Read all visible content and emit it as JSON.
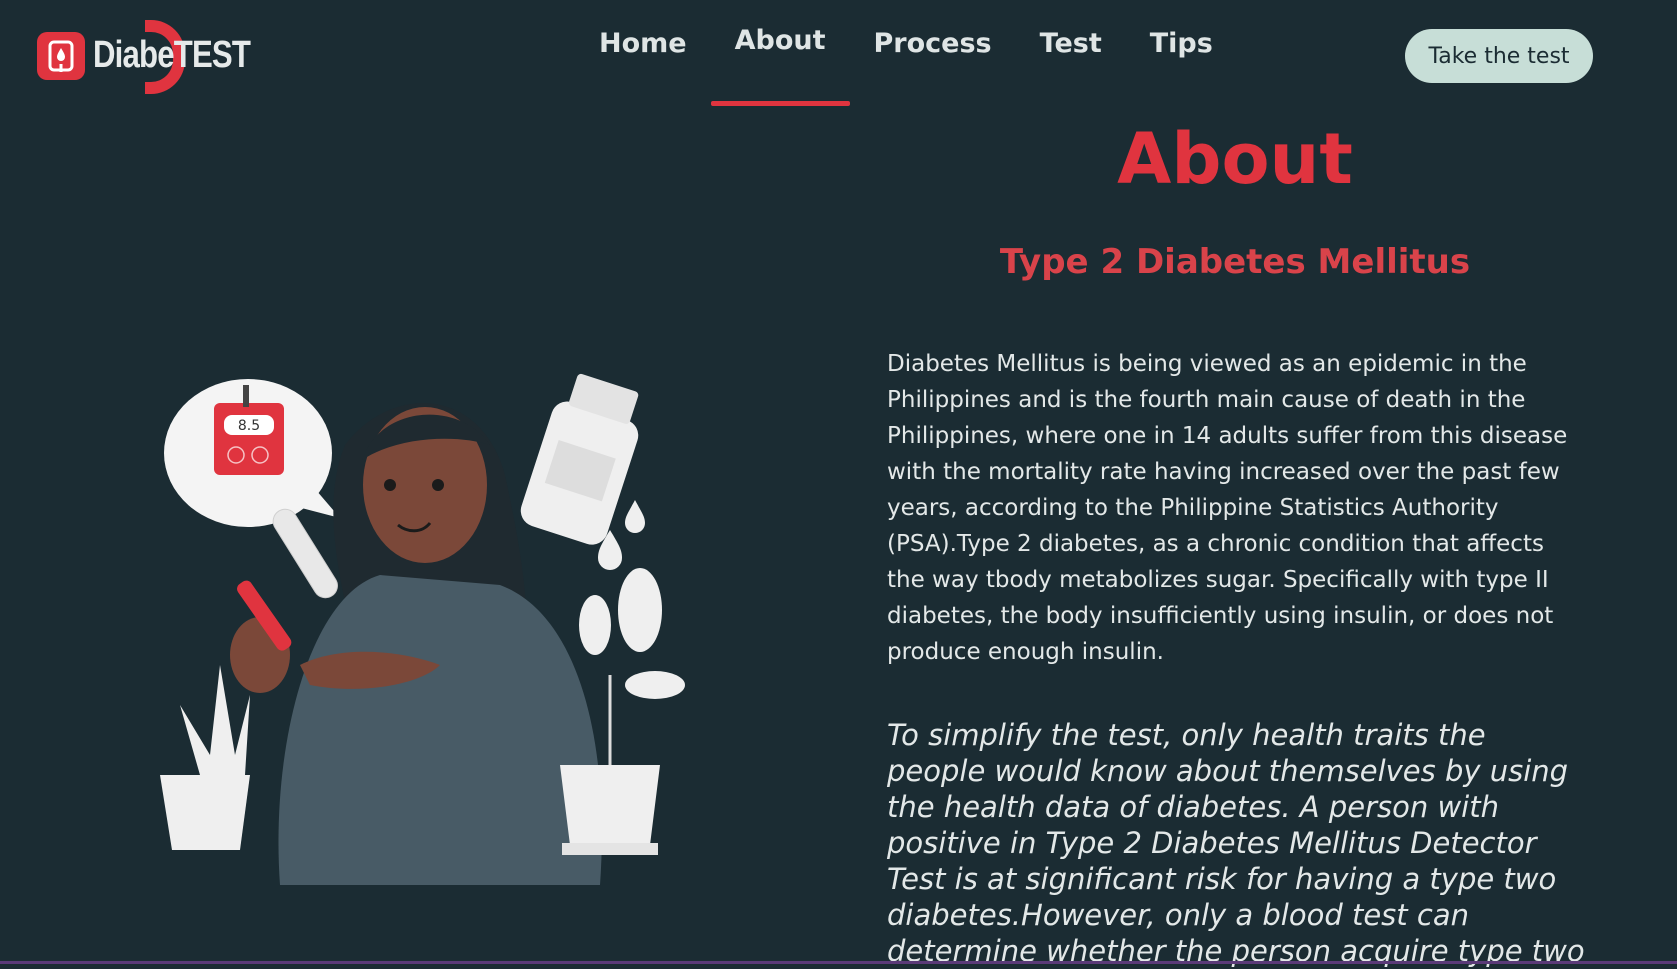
{
  "brand": {
    "logo_text": "DiabeTEST"
  },
  "nav": {
    "items": [
      {
        "label": "Home"
      },
      {
        "label": "About"
      },
      {
        "label": "Process"
      },
      {
        "label": "Test"
      },
      {
        "label": "Tips"
      }
    ],
    "active": "About",
    "cta_label": "Take the test"
  },
  "about": {
    "title": "About",
    "subtitle": "Type 2 Diabetes Mellitus",
    "paragraph": "Diabetes Mellitus is being viewed as an epidemic in the Philippines and is the fourth main cause of death in the Philippines, where one in 14 adults suffer from this disease with the mortality rate having increased over the past few years, according to the Philippine Statistics Authority (PSA).Type 2 diabetes, as a chronic condition that affects the way tbody metabolizes sugar. Specifically with type II diabetes, the body insufficiently using insulin, or does not produce enough insulin.",
    "paragraph_italic": "To simplify the test, only health traits the people would know about themselves by using the health data of diabetes. A person with positive in Type 2 Diabetes Mellitus Detector Test is at significant risk for having a type two diabetes.However, only a blood test can determine whether the person acquire type two"
  },
  "illustration": {
    "meter_value": "8.5"
  },
  "colors": {
    "background": "#1b2c33",
    "accent": "#e0343f",
    "cta": "#c7ded7"
  }
}
